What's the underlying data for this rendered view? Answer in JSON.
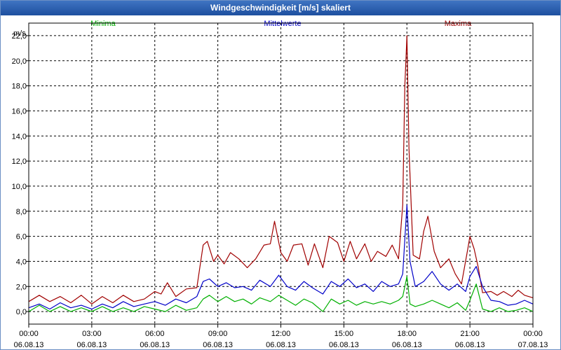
{
  "window": {
    "title": "Windgeschwindigkeit [m/s] skaliert"
  },
  "legend": {
    "minima": "Minima",
    "mittelwerte": "Mittelwerte",
    "maxima": "Maxima"
  },
  "colors": {
    "minima": "#00b000",
    "mittelwerte": "#0000c8",
    "maxima": "#a00000",
    "grid": "#000000"
  },
  "chart_data": {
    "type": "line",
    "title": "Windgeschwindigkeit [m/s] skaliert",
    "ylabel": "m/s",
    "ylim": [
      -1,
      23
    ],
    "yticks": [
      "0,0",
      "2,0",
      "4,0",
      "6,0",
      "8,0",
      "10,0",
      "12,0",
      "14,0",
      "16,0",
      "18,0",
      "20,0",
      "22,0"
    ],
    "xticks": [
      {
        "time": "00:00",
        "date": "06.08.13"
      },
      {
        "time": "03:00",
        "date": "06.08.13"
      },
      {
        "time": "06:00",
        "date": "06.08.13"
      },
      {
        "time": "09:00",
        "date": "06.08.13"
      },
      {
        "time": "12:00",
        "date": "06.08.13"
      },
      {
        "time": "15:00",
        "date": "06.08.13"
      },
      {
        "time": "18:00",
        "date": "06.08.13"
      },
      {
        "time": "21:00",
        "date": "06.08.13"
      },
      {
        "time": "00:00",
        "date": "07.08.13"
      }
    ],
    "grid": true,
    "legend_position": "top",
    "series": [
      {
        "name": "Maxima",
        "x_hours": [
          0,
          0.5,
          1,
          1.5,
          2,
          2.5,
          3,
          3.5,
          4,
          4.5,
          5,
          5.5,
          6,
          6.3,
          6.6,
          7,
          7.5,
          8,
          8.3,
          8.5,
          8.8,
          9,
          9.3,
          9.6,
          10,
          10.4,
          10.8,
          11.2,
          11.5,
          11.7,
          12,
          12.3,
          12.6,
          13,
          13.3,
          13.6,
          14,
          14.3,
          14.7,
          15,
          15.3,
          15.6,
          16,
          16.3,
          16.6,
          17,
          17.3,
          17.6,
          17.8,
          17.9,
          18,
          18.1,
          18.3,
          18.6,
          18.8,
          19,
          19.3,
          19.6,
          20,
          20.3,
          20.6,
          20.9,
          21,
          21.2,
          21.4,
          21.6,
          22,
          22.3,
          22.6,
          23,
          23.3,
          23.6,
          24
        ],
        "values": [
          0.8,
          1.3,
          0.8,
          1.2,
          0.7,
          1.3,
          0.6,
          1.2,
          0.7,
          1.3,
          0.8,
          1.0,
          1.6,
          1.4,
          2.3,
          1.2,
          1.8,
          1.9,
          5.3,
          5.6,
          4.0,
          4.5,
          3.8,
          4.7,
          4.2,
          3.5,
          4.2,
          5.3,
          5.4,
          7.2,
          4.7,
          4.0,
          5.3,
          5.4,
          3.7,
          5.4,
          3.5,
          6.0,
          5.5,
          4.0,
          5.6,
          4.2,
          5.4,
          4.0,
          4.8,
          4.4,
          5.3,
          4.2,
          8.5,
          18.0,
          22.0,
          13.0,
          4.5,
          4.2,
          6.4,
          7.6,
          4.8,
          3.5,
          4.2,
          3.0,
          2.2,
          5.0,
          6.0,
          5.0,
          3.5,
          1.5,
          1.6,
          1.3,
          1.6,
          1.2,
          1.7,
          1.3,
          1.1
        ]
      },
      {
        "name": "Mittelwerte",
        "x_hours": [
          0,
          0.5,
          1,
          1.5,
          2,
          2.5,
          3,
          3.5,
          4,
          4.5,
          5,
          5.5,
          6,
          6.5,
          7,
          7.5,
          8,
          8.3,
          8.6,
          9,
          9.4,
          9.8,
          10.2,
          10.6,
          11,
          11.5,
          11.9,
          12.3,
          12.7,
          13.1,
          13.5,
          14,
          14.4,
          14.8,
          15.2,
          15.6,
          16,
          16.4,
          16.8,
          17.2,
          17.6,
          17.8,
          18,
          18.15,
          18.4,
          18.8,
          19.2,
          19.6,
          20,
          20.4,
          20.8,
          21,
          21.3,
          21.6,
          22,
          22.4,
          22.8,
          23.2,
          23.6,
          24
        ],
        "values": [
          0.3,
          0.6,
          0.2,
          0.7,
          0.3,
          0.5,
          0.2,
          0.6,
          0.3,
          0.8,
          0.4,
          0.6,
          0.8,
          0.5,
          1.0,
          0.7,
          1.2,
          2.4,
          2.6,
          2.0,
          2.3,
          1.9,
          2.0,
          1.7,
          2.5,
          2.0,
          2.9,
          2.0,
          1.7,
          2.4,
          1.9,
          1.4,
          2.4,
          2.0,
          2.6,
          1.9,
          2.2,
          1.6,
          2.4,
          2.0,
          2.2,
          3.0,
          8.5,
          4.0,
          2.0,
          2.4,
          3.2,
          2.2,
          1.7,
          2.2,
          1.6,
          2.8,
          3.6,
          2.0,
          0.9,
          0.8,
          0.5,
          0.6,
          0.9,
          0.6
        ]
      },
      {
        "name": "Minima",
        "x_hours": [
          0,
          0.5,
          1,
          1.5,
          2,
          2.5,
          3,
          3.5,
          4,
          4.5,
          5,
          5.5,
          6,
          6.5,
          7,
          7.5,
          8,
          8.3,
          8.6,
          9,
          9.4,
          9.8,
          10.2,
          10.6,
          11,
          11.5,
          11.9,
          12.3,
          12.7,
          13.1,
          13.5,
          14,
          14.4,
          14.8,
          15.2,
          15.6,
          16,
          16.4,
          16.8,
          17.2,
          17.6,
          17.8,
          18,
          18.15,
          18.4,
          18.8,
          19.2,
          19.6,
          20,
          20.4,
          20.8,
          21,
          21.3,
          21.6,
          22,
          22.4,
          22.8,
          23.2,
          23.6,
          24
        ],
        "values": [
          0.0,
          0.5,
          0.0,
          0.4,
          0.0,
          0.3,
          0.0,
          0.4,
          0.0,
          0.3,
          0.0,
          0.4,
          0.2,
          0.0,
          0.5,
          0.1,
          0.3,
          1.0,
          1.3,
          0.8,
          1.2,
          0.8,
          1.0,
          0.6,
          1.1,
          0.8,
          1.3,
          0.9,
          0.5,
          1.0,
          0.7,
          0.0,
          1.0,
          0.6,
          0.9,
          0.5,
          0.8,
          0.6,
          0.8,
          0.6,
          0.9,
          1.2,
          2.8,
          0.6,
          0.4,
          0.6,
          0.9,
          0.6,
          0.3,
          0.7,
          0.1,
          0.9,
          2.2,
          0.2,
          0.0,
          0.3,
          0.0,
          0.1,
          0.3,
          0.0
        ]
      }
    ]
  }
}
